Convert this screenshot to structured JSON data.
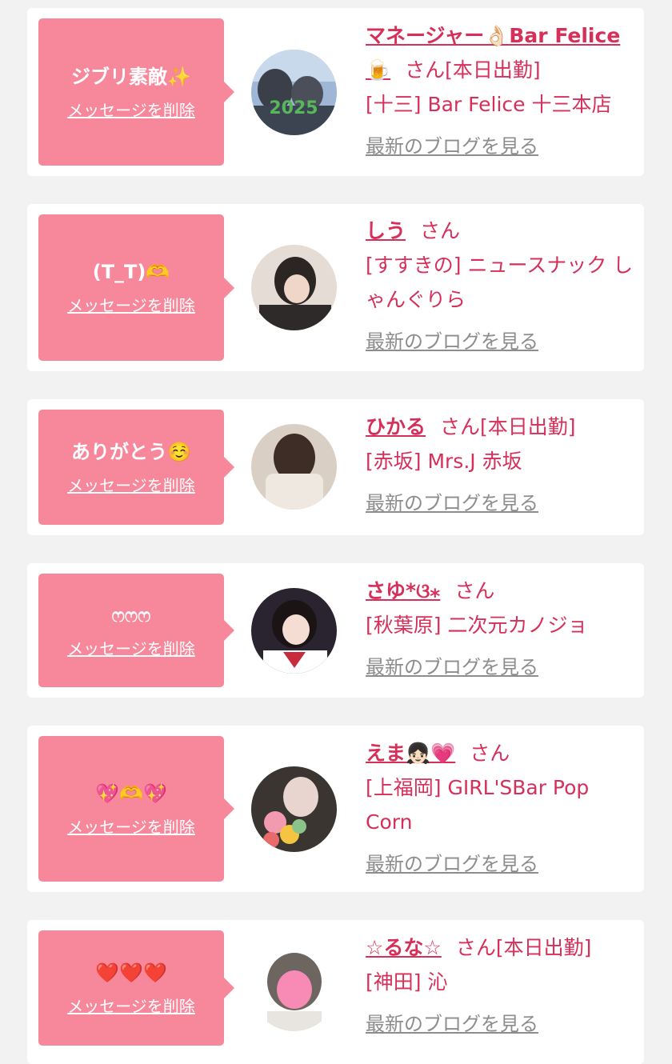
{
  "cards": [
    {
      "message": "ジブリ素敵✨",
      "delete_label": "メッセージを削除",
      "name": "マネージャー👌🏻Bar Felice🍺",
      "san": "さん",
      "status": "[本日出勤]",
      "shop": "[十三] Bar Felice 十三本店",
      "blog_label": "最新のブログを見る",
      "avatar_text": "2025"
    },
    {
      "message": "(T_T)🫶",
      "delete_label": "メッセージを削除",
      "name": "しう",
      "san": "さん",
      "status": "",
      "shop": "[すすきの] ニュースナック しゃんぐりら",
      "blog_label": "最新のブログを見る"
    },
    {
      "message": "ありがとう☺️",
      "delete_label": "メッセージを削除",
      "name": "ひかる",
      "san": "さん",
      "status": "[本日出勤]",
      "shop": "[赤坂] Mrs.J 赤坂",
      "blog_label": "最新のブログを見る"
    },
    {
      "message": "ෆෆෆ",
      "delete_label": "メッセージを削除",
      "name": "さゆ*ଓ⁎",
      "san": "さん",
      "status": "",
      "shop": "[秋葉原] 二次元カノジョ",
      "blog_label": "最新のブログを見る"
    },
    {
      "message": "💖🫶💖",
      "delete_label": "メッセージを削除",
      "name": "えま👧🏻💗",
      "san": "さん",
      "status": "",
      "shop": "[上福岡] GIRL'SBar Pop Corn",
      "blog_label": "最新のブログを見る"
    },
    {
      "message": "❤️❤️❤️",
      "delete_label": "メッセージを削除",
      "name": "☆るな☆",
      "san": "さん",
      "status": "[本日出勤]",
      "shop": "[神田] 沁",
      "blog_label": "最新のブログを見る"
    }
  ],
  "colors": {
    "bubble": "#f7879a",
    "name": "#d6305a",
    "blog_link": "#8d8d8d",
    "background": "#f2f2f2"
  }
}
